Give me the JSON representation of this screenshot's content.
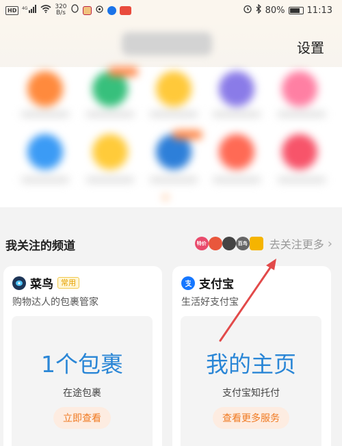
{
  "status_bar": {
    "hd_label": "HD",
    "network_label": "4G",
    "speed_value": "320",
    "speed_unit": "B/s",
    "battery": "80%",
    "time": "11:13",
    "mini_app_color": "#e94b3c"
  },
  "header": {
    "settings_label": "设置"
  },
  "channels": {
    "title": "我关注的频道",
    "follow_more_label": "去关注更多",
    "follow_avatars": [
      {
        "label": "特价",
        "color": "#e94b6c"
      },
      {
        "label": "",
        "color": "#e9573c"
      },
      {
        "label": "",
        "color": "#444444"
      },
      {
        "label": "百鸟",
        "color": "#666666"
      },
      {
        "label": "",
        "color": "#f5b400"
      }
    ],
    "cards": [
      {
        "name": "菜鸟",
        "badge": "常用",
        "subtitle": "购物达人的包裹管家",
        "highlight": "1个包裹",
        "detail": "在途包裹",
        "action": "立即查看",
        "logo_color": "#1d3557"
      },
      {
        "name": "支付宝",
        "badge": "",
        "subtitle": "生活好支付宝",
        "highlight": "我的主页",
        "detail": "支付宝知托付",
        "action": "查看更多服务",
        "logo_color": "#1677ff"
      }
    ]
  },
  "colors": {
    "accent_orange": "#f07a22",
    "accent_blue": "#2a86d6",
    "annotation_red": "#e24a4a"
  }
}
